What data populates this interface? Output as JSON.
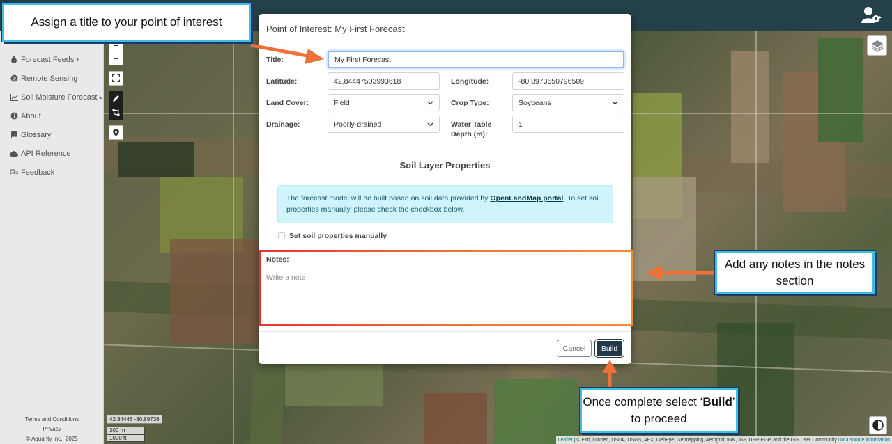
{
  "map": {
    "coords": "42.84448  -80.89736",
    "scale_metric": "300 m",
    "scale_imperial": "1000 ft",
    "attribution_leaflet": "Leaflet",
    "attribution_text": "| © Esri, i-cubed, USDA, USGS, AEX, GeoEye, Getmapping, Aerogrid, IGN, IGP, UPR-EGP, and the GIS User Community",
    "attribution_link": "Data source information"
  },
  "sidebar": {
    "items": [
      {
        "label": "Forecast Feeds",
        "icon": "droplet-icon",
        "caret": "▾"
      },
      {
        "label": "Remote Sensing",
        "icon": "globe-icon"
      },
      {
        "label": "Soil Moisture Forecast",
        "icon": "chart-line-icon",
        "caret": "▴"
      },
      {
        "label": "About",
        "icon": "info-icon"
      },
      {
        "label": "Glossary",
        "icon": "book-icon"
      },
      {
        "label": "API Reference",
        "icon": "cloud-icon"
      },
      {
        "label": "Feedback",
        "icon": "comments-icon"
      }
    ],
    "footer": {
      "terms": "Terms and Conditions",
      "privacy": "Privacy",
      "copyright": "© Aquanty Inc., 2025"
    }
  },
  "modal": {
    "title": "Point of Interest: My First Forecast",
    "fields": {
      "title_label": "Title:",
      "title_value": "My First Forecast",
      "latitude_label": "Latitude:",
      "latitude_value": "42.84447503993618",
      "longitude_label": "Longitude:",
      "longitude_value": "-80.8973550796509",
      "land_cover_label": "Land Cover:",
      "land_cover_value": "Field",
      "crop_type_label": "Crop Type:",
      "crop_type_value": "Soybeans",
      "drainage_label": "Drainage:",
      "drainage_value": "Poorly-drained",
      "water_table_label": "Water Table Depth (m):",
      "water_table_value": "1"
    },
    "soil_section_title": "Soil Layer Properties",
    "info_text_before": "The forecast model will be built based on soil data provided by ",
    "info_link": "OpenLandMap portal",
    "info_text_after": ". To set soil properties manually, please check the checkbox below.",
    "checkbox_label": "Set soil properties manually",
    "notes_label": "Notes:",
    "notes_placeholder": "Write a note",
    "cancel_label": "Cancel",
    "build_label": "Build"
  },
  "annotations": {
    "title_callout": "Assign a title to your point of interest",
    "notes_callout": "Add any notes in the notes section",
    "build_callout_before": "Once complete select ‘",
    "build_callout_bold": "Build",
    "build_callout_after": "’ to proceed",
    "accent_color": "#3fbfe0",
    "arrow_color": "#f0703a"
  }
}
